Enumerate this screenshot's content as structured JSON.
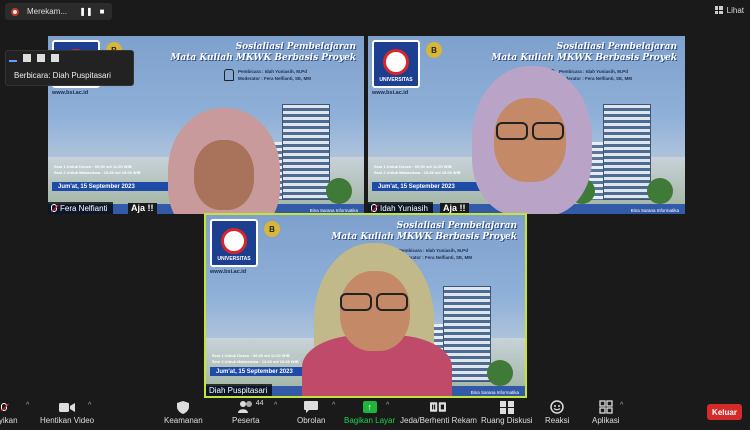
{
  "recording": {
    "label": "Merekam...",
    "pause_icon": "pause-icon",
    "stop_icon": "stop-icon"
  },
  "view_button": {
    "label": "Lihat",
    "icon": "grid-icon"
  },
  "speaker_popup": {
    "label": "Berbicara: Diah Puspitasari"
  },
  "slide": {
    "logo_text": "UNIVERSITAS",
    "medal": "B",
    "title_line1": "Sosialiasi Pembelajaran",
    "title_line2": "Mata Kuliah MKWK Berbasis Proyek",
    "speaker_line": "Pembicara : Idah Yuniasih, M.Pd",
    "moderator_line": "Moderator : Fera Nelfianti, SE, MM",
    "website": "www.bsi.ac.id",
    "zoom": "zoom",
    "session1": "Sesi 1 Untuk Dosen : 09.00 s/d 11.00 WIB",
    "session2": "Sesi 2 Untuk Mahasiswa : 13.00 s/d 15.00 WIB",
    "date": "Jum'at, 15 September 2023",
    "aja": "Aja !!",
    "social": "Bina Sarana Informatika"
  },
  "participants": [
    {
      "name": "Fera Nelfianti",
      "muted": true
    },
    {
      "name": "Idah Yuniasih",
      "muted": true
    },
    {
      "name": "Diah Puspitasari",
      "muted": false
    }
  ],
  "colors": {
    "active_speaker_border": "#c6e33a",
    "leave_button": "#d42a2a",
    "share_button": "#1fb53a"
  },
  "toolbar": {
    "unmute": "unyikan",
    "stop_video": "Hentikan Video",
    "security": "Keamanan",
    "participants": "Peserta",
    "participants_count": "44",
    "chat": "Obrolan",
    "share": "Bagikan Layar",
    "pause_record": "Jeda/Berhenti Rekam",
    "breakout": "Ruang Diskusi",
    "reactions": "Reaksi",
    "apps": "Aplikasi",
    "leave": "Keluar"
  }
}
